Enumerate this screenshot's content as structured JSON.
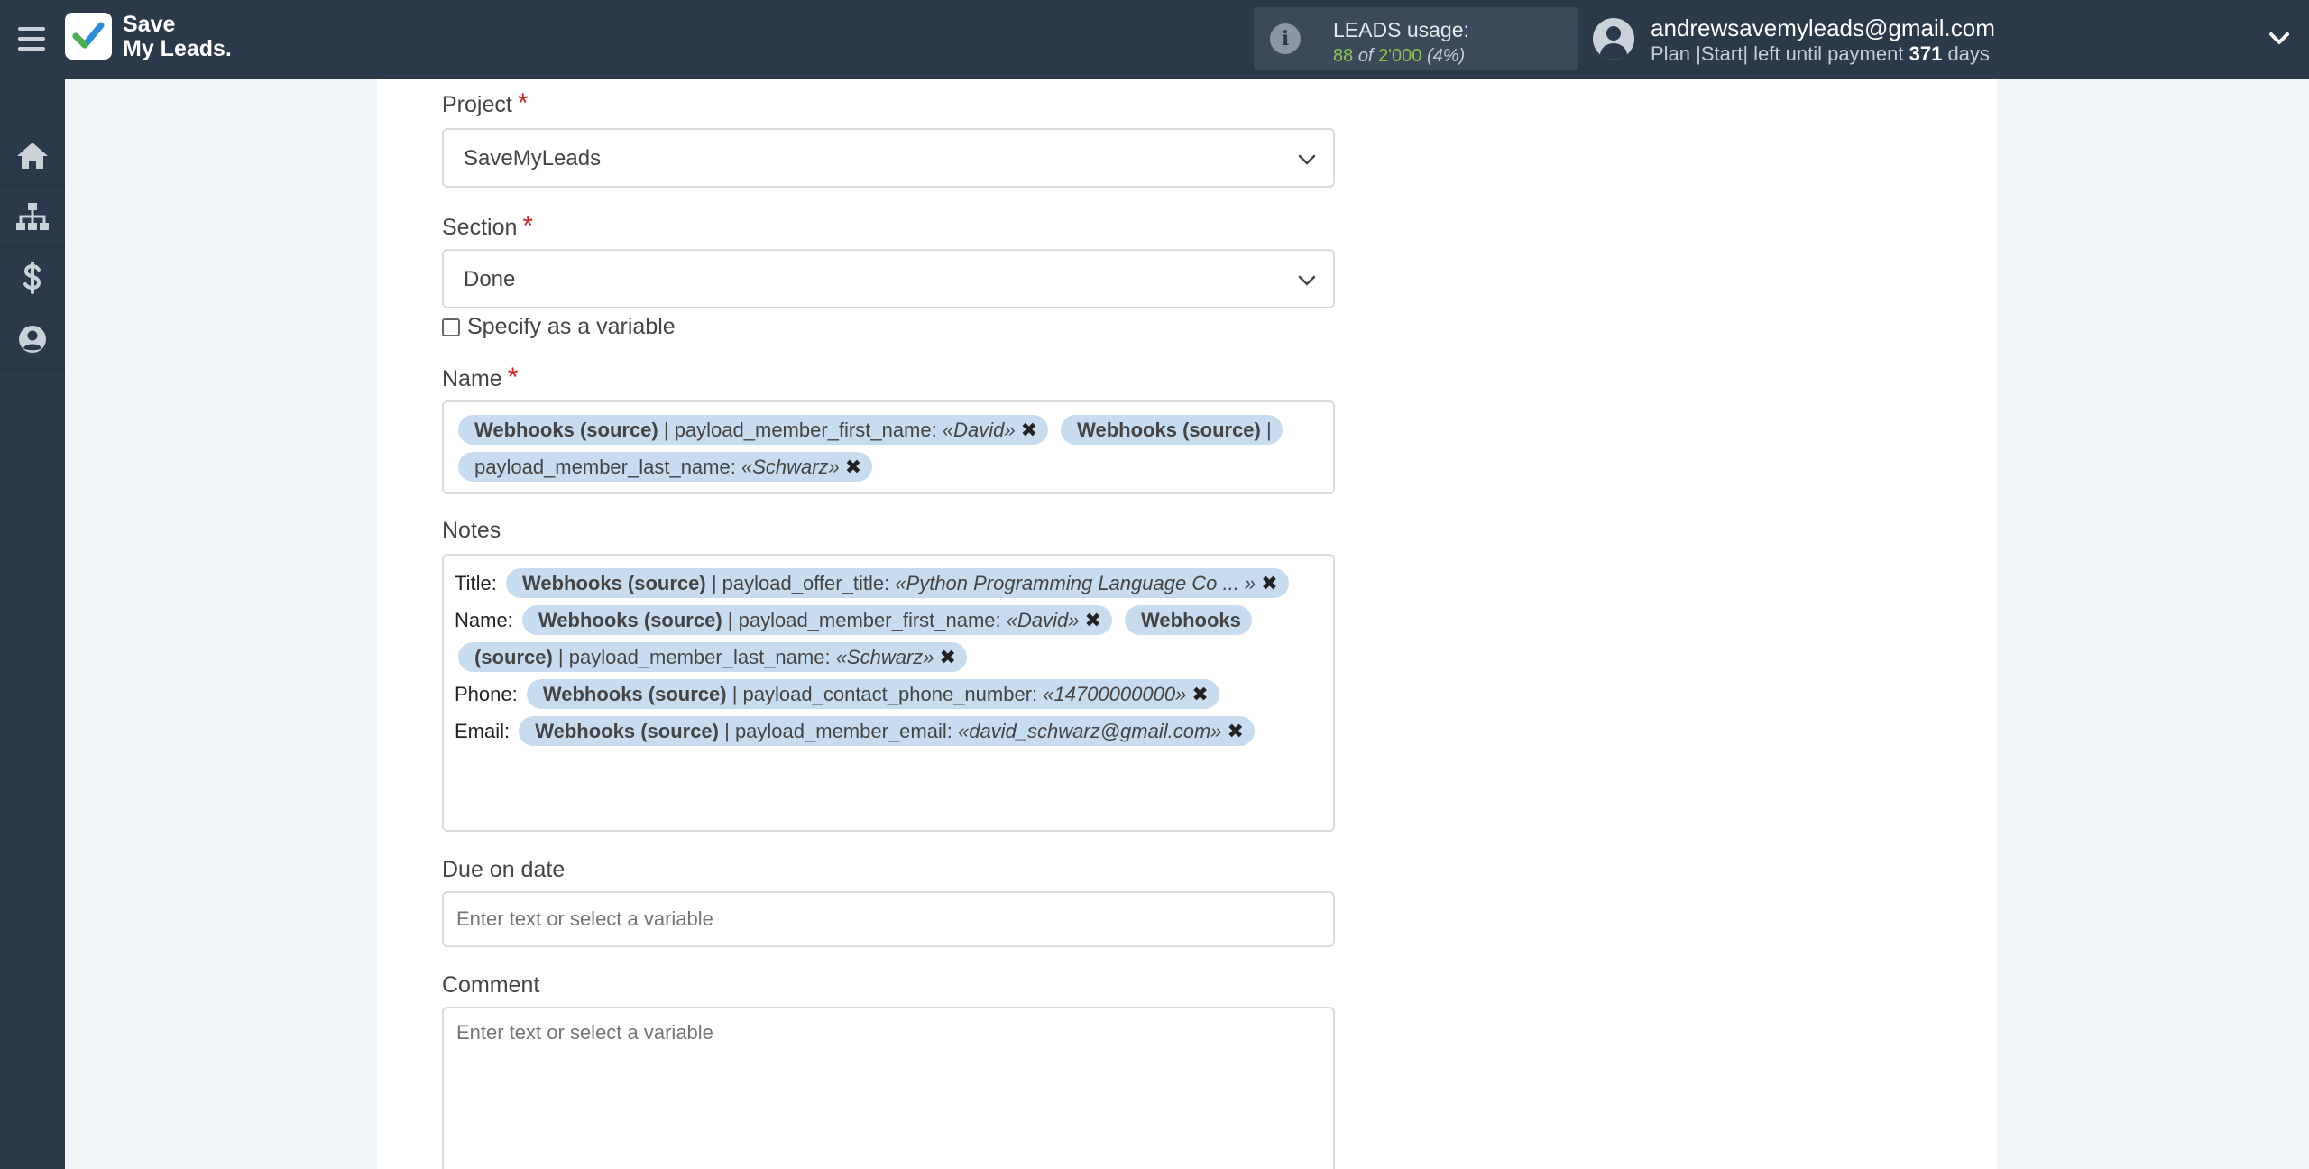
{
  "header": {
    "logo_line1": "Save",
    "logo_line2": "My Leads.",
    "usage_label": "LEADS usage:",
    "usage_used": "88",
    "usage_of": "of",
    "usage_total": "2'000",
    "usage_pct": "(4%)",
    "user_email": "andrewsavemyleads@gmail.com",
    "plan_text": "Plan |Start| left until payment",
    "plan_days": "371",
    "plan_days_unit": "days"
  },
  "sidebar": {
    "items": [
      {
        "name": "home-icon"
      },
      {
        "name": "sitemap-icon"
      },
      {
        "name": "dollar-icon"
      },
      {
        "name": "user-icon"
      }
    ]
  },
  "form": {
    "project": {
      "label": "Project",
      "value": "SaveMyLeads"
    },
    "section": {
      "label": "Section",
      "value": "Done"
    },
    "specify_variable": "Specify as a variable",
    "name": {
      "label": "Name",
      "tags": [
        {
          "source": "Webhooks (source)",
          "sep": " | payload_member_first_name: ",
          "value": "«David»"
        },
        {
          "source": "Webhooks (source)",
          "sep": " | payload_member_last_name: ",
          "value": "«Schwarz»"
        }
      ]
    },
    "notes": {
      "label": "Notes",
      "rows": [
        {
          "label": "Title:",
          "tags": [
            {
              "source": "Webhooks (source)",
              "sep": " | payload_offer_title: ",
              "value": "«Python Programming Language Co ... »"
            }
          ]
        },
        {
          "label": "Name:",
          "tags": [
            {
              "source": "Webhooks (source)",
              "sep": " | payload_member_first_name: ",
              "value": "«David»"
            },
            {
              "source": "Webhooks (source)",
              "sep": " | payload_member_last_name: ",
              "value": "«Schwarz»"
            }
          ]
        },
        {
          "label": "Phone:",
          "tags": [
            {
              "source": "Webhooks (source)",
              "sep": " | payload_contact_phone_number: ",
              "value": "«14700000000»"
            }
          ]
        },
        {
          "label": "Email:",
          "tags": [
            {
              "source": "Webhooks (source)",
              "sep": " | payload_member_email: ",
              "value": "«david_schwarz@gmail.com»"
            }
          ]
        }
      ]
    },
    "due_date": {
      "label": "Due on date",
      "placeholder": "Enter text or select a variable"
    },
    "comment": {
      "label": "Comment",
      "placeholder": "Enter text or select a variable"
    },
    "tag_remove_glyph": "✖"
  }
}
